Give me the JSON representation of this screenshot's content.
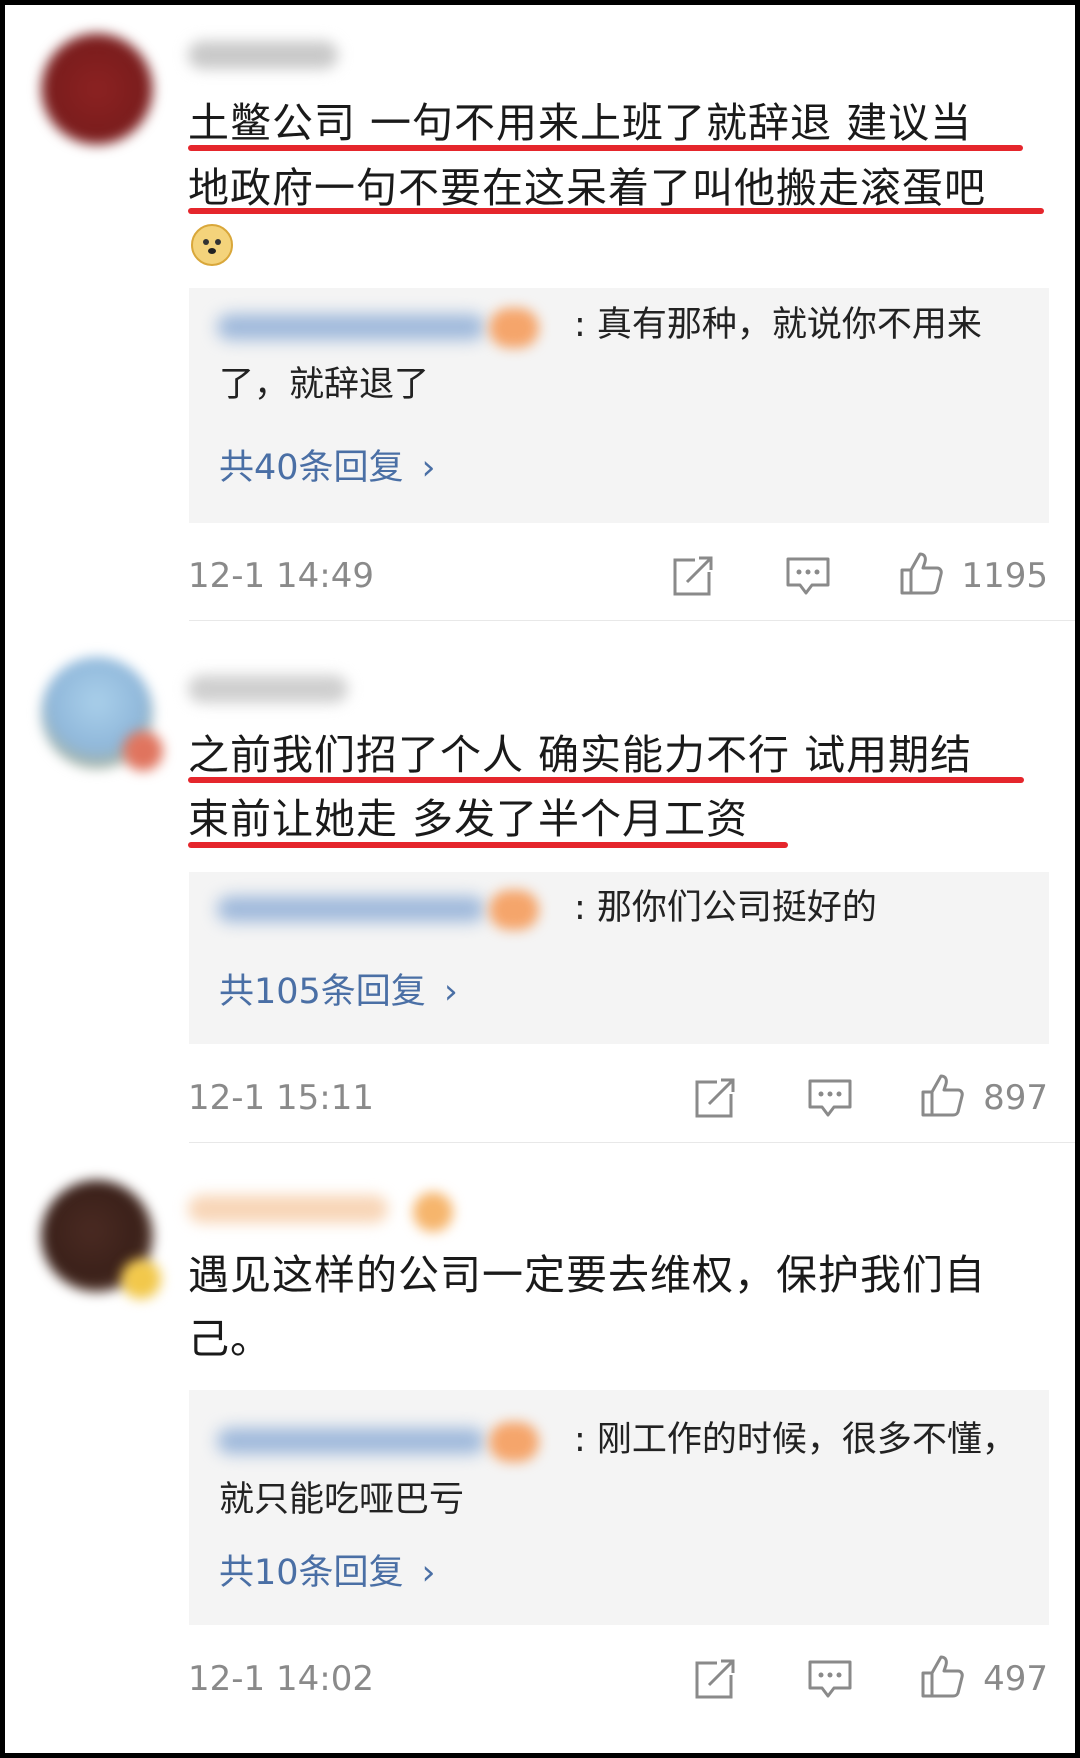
{
  "comments": [
    {
      "lines": [
        "土鳖公司 一句不用来上班了就辞退 建议当",
        "地政府一句不要在这呆着了叫他搬走滚蛋吧"
      ],
      "emoji": "doge-emoji",
      "reply": {
        "text": ": 真有那种，就说你不用来了，就辞退了",
        "more": "共40条回复"
      },
      "time": "12-1 14:49",
      "likes": "1195"
    },
    {
      "lines": [
        "之前我们招了个人 确实能力不行 试用期结",
        "束前让她走 多发了半个月工资"
      ],
      "reply": {
        "text": ": 那你们公司挺好的",
        "more": "共105条回复"
      },
      "time": "12-1 15:11",
      "likes": "897"
    },
    {
      "text": "遇见这样的公司一定要去维权，保护我们自己。",
      "reply": {
        "text": ": 刚工作的时候，很多不懂，就只能吃哑巴亏",
        "more": "共10条回复"
      },
      "time": "12-1 14:02",
      "likes": "497"
    }
  ],
  "icons": {
    "share": "share-icon",
    "comment": "comment-icon",
    "like": "like-icon",
    "more": "chevron-right-icon"
  },
  "colors": {
    "underline": "#e5262c",
    "link": "#4a6fa5",
    "meta": "#8a8a8a",
    "reply_bg": "#f4f4f4"
  }
}
